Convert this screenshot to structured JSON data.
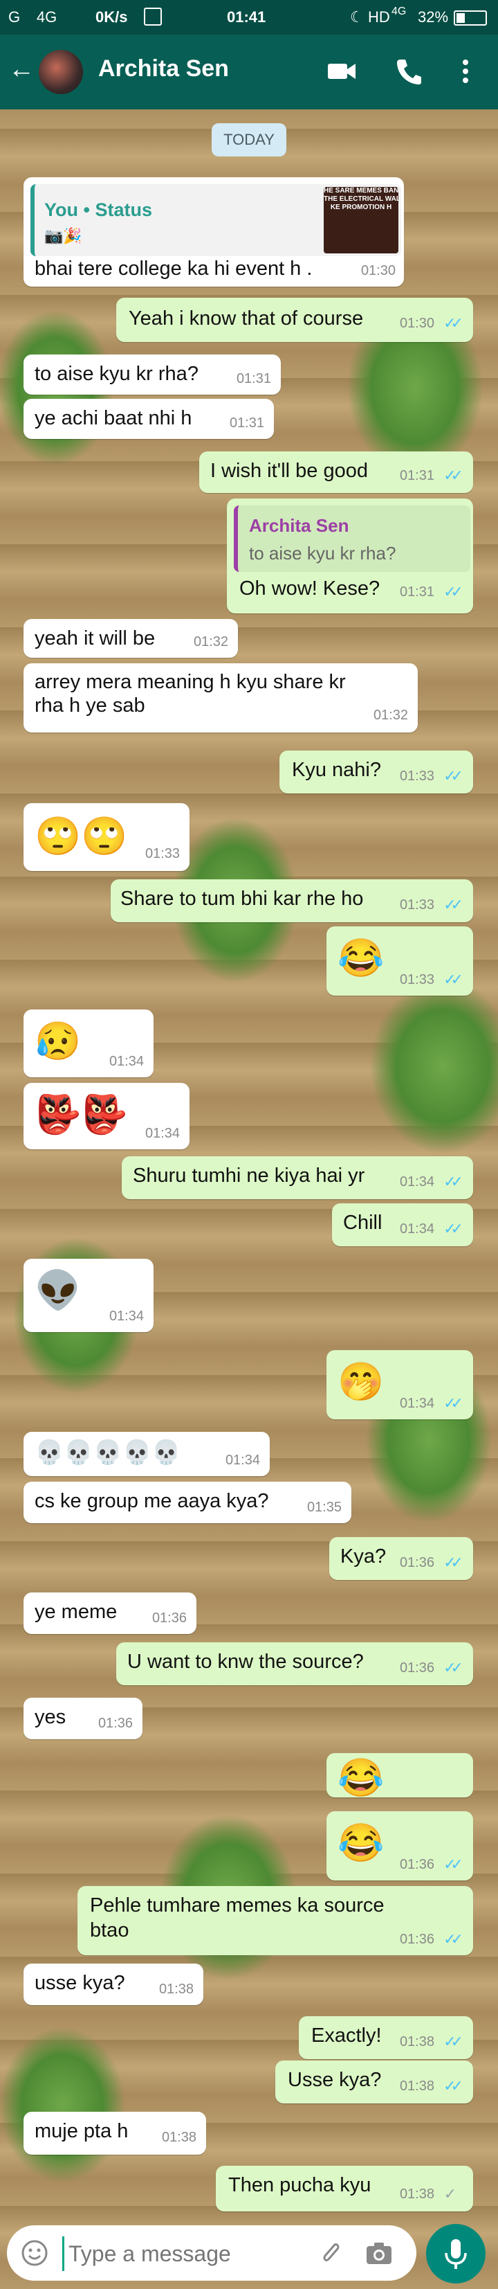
{
  "status_bar": {
    "network": "G     4G    ",
    "speed": "0K/s",
    "time": "01:41",
    "hd": "HD",
    "net2": "4G",
    "battery": "32%"
  },
  "header": {
    "contact_name": "Archita Sen"
  },
  "date_chip": "TODAY",
  "reply_card_1": {
    "author": "You • Status",
    "thumb_text": "HE SARE MEMES BANI\nTHE ELECTRICAL WALO\nKE PROMOTION H"
  },
  "reply_card_2": {
    "author": "Archita Sen",
    "text": "to aise kyu kr rha?"
  },
  "messages": [
    {
      "text": "bhai tere college ka hi event h .",
      "time": "01:30"
    },
    {
      "text": "Yeah i know that of course",
      "time": "01:30"
    },
    {
      "text": "to aise kyu kr rha?",
      "time": "01:31"
    },
    {
      "text": "ye achi baat nhi h",
      "time": "01:31"
    },
    {
      "text": "I wish it'll be good",
      "time": "01:31"
    },
    {
      "text": "Oh wow! Kese?",
      "time": "01:31"
    },
    {
      "text": "yeah it will be",
      "time": "01:32"
    },
    {
      "text": "arrey mera meaning h kyu share kr\nrha h ye sab",
      "time": "01:32"
    },
    {
      "text": "Kyu nahi?",
      "time": "01:33"
    },
    {
      "text": "🙄🙄",
      "time": "01:33"
    },
    {
      "text": "Share to tum bhi kar rhe ho",
      "time": "01:33"
    },
    {
      "text": "😂",
      "time": "01:33"
    },
    {
      "text": "😥",
      "time": "01:34"
    },
    {
      "text": "👺👺",
      "time": "01:34"
    },
    {
      "text": "Shuru tumhi ne kiya hai yr",
      "time": "01:34"
    },
    {
      "text": "Chill",
      "time": "01:34"
    },
    {
      "text": "👽",
      "time": "01:34"
    },
    {
      "text": "🤭",
      "time": "01:34"
    },
    {
      "text": "💀💀💀💀💀",
      "time": "01:34"
    },
    {
      "text": "cs ke group me aaya kya?",
      "time": "01:35"
    },
    {
      "text": "Kya?",
      "time": "01:36"
    },
    {
      "text": "ye meme",
      "time": "01:36"
    },
    {
      "text": "U want to knw the source?",
      "time": "01:36"
    },
    {
      "text": "yes",
      "time": "01:36"
    },
    {
      "text": "😂",
      "time": ""
    },
    {
      "text": "😂",
      "time": "01:36"
    },
    {
      "text": "Pehle tumhare memes ka source\nbtao",
      "time": "01:36"
    },
    {
      "text": "usse kya?",
      "time": "01:38"
    },
    {
      "text": "Exactly!",
      "time": "01:38"
    },
    {
      "text": "Usse kya?",
      "time": "01:38"
    },
    {
      "text": "muje pta h",
      "time": "01:38"
    },
    {
      "text": "Then pucha kyu",
      "time": "01:38"
    }
  ],
  "input": {
    "placeholder": "Type a message"
  }
}
